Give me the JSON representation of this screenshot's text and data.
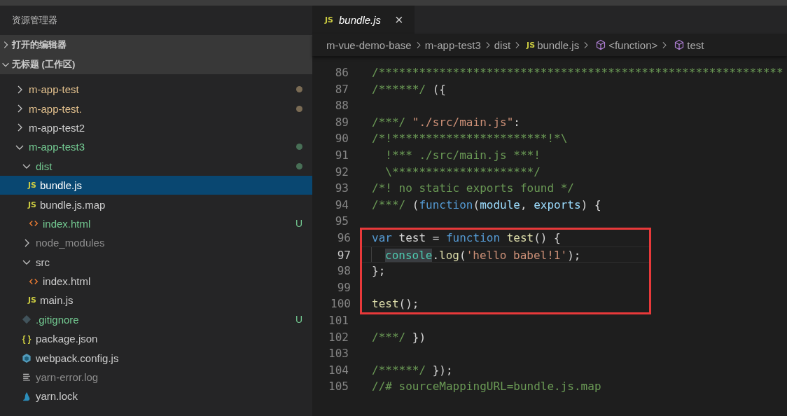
{
  "sidebar": {
    "title": "资源管理器",
    "sections": [
      {
        "label": "打开的编辑器",
        "expanded": false
      },
      {
        "label": "无标题 (工作区)",
        "expanded": true
      }
    ],
    "tree": [
      {
        "name": "m-app-test",
        "kind": "folder",
        "expanded": false,
        "selected": false,
        "color": "#e2c08d",
        "dot": true
      },
      {
        "name": "m-app-test.",
        "kind": "folder",
        "expanded": false,
        "selected": false,
        "color": "#e2c08d",
        "dot": true
      },
      {
        "name": "m-app-test2",
        "kind": "folder",
        "expanded": false,
        "selected": false,
        "color": "#cccccc",
        "dot": false
      },
      {
        "name": "m-app-test3",
        "kind": "folder",
        "expanded": true,
        "selected": false,
        "color": "#73c991",
        "dot": true,
        "children": [
          {
            "name": "dist",
            "kind": "folder",
            "expanded": true,
            "selected": false,
            "color": "#73c991",
            "dot": true,
            "children": [
              {
                "name": "bundle.js",
                "kind": "js",
                "icon": "JS",
                "selected": true,
                "color": "#ffffff",
                "dot": false
              },
              {
                "name": "bundle.js.map",
                "kind": "js",
                "icon": "JS",
                "selected": false,
                "color": "#cccccc",
                "dot": false
              },
              {
                "name": "index.html",
                "kind": "html",
                "selected": false,
                "color": "#73c991",
                "dot": false,
                "badge": "U"
              }
            ]
          },
          {
            "name": "node_modules",
            "kind": "folder",
            "expanded": false,
            "selected": false,
            "color": "#8c8c8c",
            "dot": false
          },
          {
            "name": "src",
            "kind": "folder",
            "expanded": true,
            "selected": false,
            "color": "#cccccc",
            "dot": false,
            "children": [
              {
                "name": "index.html",
                "kind": "html",
                "selected": false,
                "color": "#cccccc",
                "dot": false
              },
              {
                "name": "main.js",
                "kind": "js",
                "icon": "JS",
                "selected": false,
                "color": "#cccccc",
                "dot": false
              }
            ]
          },
          {
            "name": ".gitignore",
            "kind": "git",
            "selected": false,
            "color": "#73c991",
            "dot": false,
            "badge": "U"
          },
          {
            "name": "package.json",
            "kind": "json",
            "icon": "{ }",
            "selected": false,
            "color": "#cccccc",
            "dot": false
          },
          {
            "name": "webpack.config.js",
            "kind": "webpack",
            "selected": false,
            "color": "#cccccc",
            "dot": false
          },
          {
            "name": "yarn-error.log",
            "kind": "log",
            "selected": false,
            "color": "#8c8c8c",
            "dot": false
          },
          {
            "name": "yarn.lock",
            "kind": "yarn",
            "selected": false,
            "color": "#cccccc",
            "dot": false
          }
        ]
      }
    ]
  },
  "tabs": [
    {
      "label": "bundle.js",
      "icon": "JS",
      "selected": true,
      "close": "×"
    }
  ],
  "breadcrumb": [
    {
      "label": "m-vue-demo-base",
      "kind": "folder"
    },
    {
      "label": "m-app-test3",
      "kind": "folder"
    },
    {
      "label": "dist",
      "kind": "folder"
    },
    {
      "label": "bundle.js",
      "kind": "js",
      "icon": "JS"
    },
    {
      "label": "<function>",
      "kind": "symbol"
    },
    {
      "label": "test",
      "kind": "symbol"
    }
  ],
  "code": [
    {
      "number": "86",
      "current": false,
      "tokens": [
        {
          "t": "/************************************************************",
          "kind": "comment"
        }
      ]
    },
    {
      "number": "87",
      "current": false,
      "tokens": [
        {
          "t": "/******/",
          "kind": "comment"
        },
        {
          "t": " ({",
          "kind": "plain"
        }
      ]
    },
    {
      "number": "88",
      "current": false
    },
    {
      "number": "89",
      "current": false,
      "tokens": [
        {
          "t": "/***/",
          "kind": "comment"
        },
        {
          "t": " \"./src/main.js\"",
          "kind": "string"
        },
        {
          "t": ":",
          "kind": "plain"
        }
      ]
    },
    {
      "number": "90",
      "current": false,
      "tokens": [
        {
          "t": "/*!***********************!*\\",
          "kind": "comment"
        }
      ]
    },
    {
      "number": "91",
      "current": false,
      "tokens": [
        {
          "t": "  !*** ./src/main.js ***!",
          "kind": "comment"
        }
      ]
    },
    {
      "number": "92",
      "current": false,
      "tokens": [
        {
          "t": "  \\*********************/",
          "kind": "comment"
        }
      ]
    },
    {
      "number": "93",
      "current": false,
      "tokens": [
        {
          "t": "/*! no static exports found */",
          "kind": "comment"
        }
      ]
    },
    {
      "number": "94",
      "current": false,
      "tokens": [
        {
          "t": "/***/",
          "kind": "comment"
        },
        {
          "t": " (",
          "kind": "plain"
        },
        {
          "t": "function",
          "kind": "keyword"
        },
        {
          "t": "(",
          "kind": "plain"
        },
        {
          "t": "module",
          "kind": "param"
        },
        {
          "t": ", ",
          "kind": "plain"
        },
        {
          "t": "exports",
          "kind": "param"
        },
        {
          "t": ") {",
          "kind": "plain"
        }
      ]
    },
    {
      "number": "95",
      "current": false
    },
    {
      "number": "96",
      "current": false,
      "boxed": true,
      "tokens": [
        {
          "t": "var",
          "kind": "keyword"
        },
        {
          "t": " test = ",
          "kind": "plain"
        },
        {
          "t": "function",
          "kind": "keyword"
        },
        {
          "t": " test",
          "kind": "func"
        },
        {
          "t": "() {",
          "kind": "plain"
        }
      ]
    },
    {
      "number": "97",
      "current": true,
      "boxed": true,
      "indented": true,
      "tokens": [
        {
          "t": "console",
          "kind": "match"
        },
        {
          "t": ".",
          "kind": "plain"
        },
        {
          "t": "log",
          "kind": "func"
        },
        {
          "t": "(",
          "kind": "plain"
        },
        {
          "t": "'hello babel!1'",
          "kind": "string"
        },
        {
          "t": ");",
          "kind": "plain"
        }
      ]
    },
    {
      "number": "98",
      "current": false,
      "boxed": true,
      "tokens": [
        {
          "t": "};",
          "kind": "plain"
        }
      ]
    },
    {
      "number": "99",
      "current": false,
      "boxed": true
    },
    {
      "number": "100",
      "current": false,
      "boxed": true,
      "tokens": [
        {
          "t": "test",
          "kind": "func"
        },
        {
          "t": "();",
          "kind": "plain"
        }
      ]
    },
    {
      "number": "101",
      "current": false
    },
    {
      "number": "102",
      "current": false,
      "tokens": [
        {
          "t": "/***/",
          "kind": "comment"
        },
        {
          "t": " })",
          "kind": "plain"
        }
      ]
    },
    {
      "number": "103",
      "current": false
    },
    {
      "number": "104",
      "current": false,
      "tokens": [
        {
          "t": "/******/",
          "kind": "comment"
        },
        {
          "t": " });",
          "kind": "plain"
        }
      ]
    },
    {
      "number": "105",
      "current": false,
      "tokens": [
        {
          "t": "//# sourceMappingURL=bundle.js.map",
          "kind": "comment"
        }
      ]
    }
  ]
}
